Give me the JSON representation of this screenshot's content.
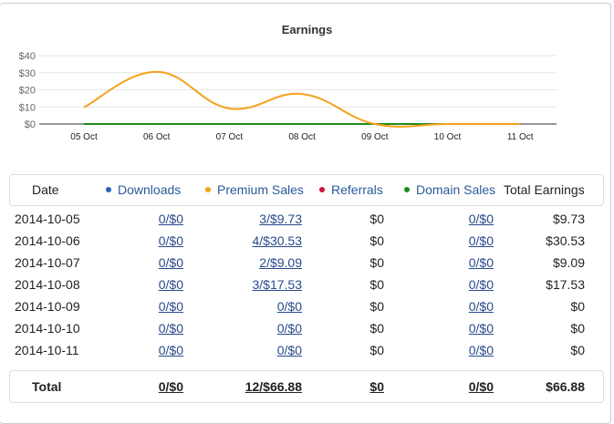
{
  "chart_data": {
    "type": "line",
    "title": "Earnings",
    "categories": [
      "05 Oct",
      "06 Oct",
      "07 Oct",
      "08 Oct",
      "09 Oct",
      "10 Oct",
      "11 Oct"
    ],
    "yticks": [
      "$0",
      "$10",
      "$20",
      "$30",
      "$40"
    ],
    "ylim": [
      0,
      40
    ],
    "series": [
      {
        "name": "Downloads",
        "color": "#2a63b8",
        "values": [
          0,
          0,
          0,
          0,
          0,
          0,
          0
        ]
      },
      {
        "name": "Referrals",
        "color": "#d0113a",
        "values": [
          0,
          0,
          0,
          0,
          0,
          0,
          0
        ]
      },
      {
        "name": "Domain Sales",
        "color": "#1e8a1e",
        "values": [
          0,
          0,
          0,
          0,
          0,
          0,
          0
        ]
      },
      {
        "name": "Premium Sales",
        "color": "#f5a11a",
        "values": [
          9.73,
          30.53,
          9.09,
          17.53,
          0,
          0,
          0
        ]
      }
    ]
  },
  "table": {
    "headers": {
      "date": "Date",
      "downloads": "Downloads",
      "premium": "Premium Sales",
      "referrals": "Referrals",
      "domain": "Domain Sales",
      "total": "Total Earnings"
    },
    "rows": [
      [
        "2014-10-05",
        "0/$0",
        "3/$9.73",
        "$0",
        "0/$0",
        "$9.73"
      ],
      [
        "2014-10-06",
        "0/$0",
        "4/$30.53",
        "$0",
        "0/$0",
        "$30.53"
      ],
      [
        "2014-10-07",
        "0/$0",
        "2/$9.09",
        "$0",
        "0/$0",
        "$9.09"
      ],
      [
        "2014-10-08",
        "0/$0",
        "3/$17.53",
        "$0",
        "0/$0",
        "$17.53"
      ],
      [
        "2014-10-09",
        "0/$0",
        "0/$0",
        "$0",
        "0/$0",
        "$0"
      ],
      [
        "2014-10-10",
        "0/$0",
        "0/$0",
        "$0",
        "0/$0",
        "$0"
      ],
      [
        "2014-10-11",
        "0/$0",
        "0/$0",
        "$0",
        "0/$0",
        "$0"
      ]
    ],
    "total": [
      "Total",
      "0/$0",
      "12/$66.88",
      "$0",
      "0/$0",
      "$66.88"
    ]
  }
}
